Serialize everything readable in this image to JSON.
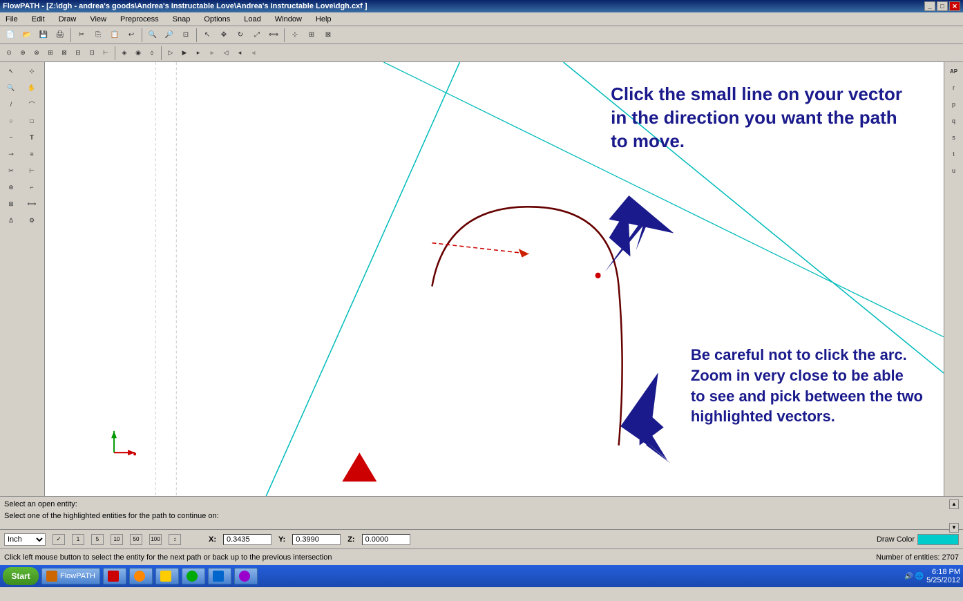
{
  "titlebar": {
    "title": "FlowPATH - [Z:\\dgh - andrea's goods\\Andrea's Instructable Love\\Andrea's Instructable Love\\dgh.cxf ]",
    "min_label": "_",
    "max_label": "□",
    "close_label": "✕"
  },
  "menubar": {
    "items": [
      "File",
      "Edit",
      "Draw",
      "View",
      "Preprocess",
      "Snap",
      "Options",
      "Load",
      "Window",
      "Help"
    ]
  },
  "annotations": {
    "top_text": "Click the small line on your vector\nin the direction you want the path\nto move.",
    "bottom_text": "Be careful not to click the arc.\nZoom in very close to be able\nto see and pick between the two\nhighlighted vectors."
  },
  "statusbar": {
    "line1": "Select an open entity:",
    "line2": "Select one of the highlighted entities for the path to continue on:"
  },
  "coords": {
    "unit": "Inch",
    "x_label": "X:",
    "x_value": "0.3435",
    "y_label": "Y:",
    "y_value": "0.3990",
    "z_label": "Z:",
    "z_value": "0.0000",
    "draw_color_label": "Draw Color"
  },
  "bottom_status": {
    "left_text": "Click left mouse button to select the entity for the next path or back up to the previous intersection",
    "right_text": "Number of entities: 2707"
  },
  "taskbar": {
    "start_label": "Start",
    "app_labels": [
      "FlowPATH",
      "Adobe Reader",
      "Firefox",
      "Folder",
      "Media",
      "App6",
      "App7"
    ],
    "time": "6:18 PM\n5/25/2012"
  },
  "snap_buttons": [
    "√",
    "1",
    "5",
    "10",
    "50",
    "100",
    "↕"
  ],
  "toolbar1_icons": [
    "open",
    "save",
    "print",
    "cut",
    "copy",
    "paste",
    "undo",
    "zoom-in",
    "zoom-out",
    "zoom-fit",
    "select",
    "move",
    "rotate",
    "scale",
    "mirror"
  ],
  "toolbar2_icons": [
    "snap1",
    "snap2",
    "snap3",
    "snap4",
    "snap5",
    "snap6",
    "snap7",
    "snap8",
    "snap9",
    "snap10",
    "snap11",
    "snap12",
    "snap13",
    "snap14",
    "snap15",
    "snap16",
    "snap17",
    "snap18",
    "snap19",
    "snap20"
  ],
  "right_sidebar_icons": [
    "AP",
    "r",
    "p",
    "q",
    "s",
    "t",
    "u"
  ],
  "left_sidebar_icons": [
    [
      "sel",
      "node"
    ],
    [
      "zoom",
      "pan"
    ],
    [
      "line",
      "arc"
    ],
    [
      "circle",
      "rect"
    ],
    [
      "spline",
      "text"
    ],
    [
      "dim",
      "hatch"
    ],
    [
      "trim",
      "ext"
    ],
    [
      "offset",
      "fillet"
    ],
    [
      "array",
      "mirror"
    ],
    [
      "T",
      "attr"
    ]
  ]
}
